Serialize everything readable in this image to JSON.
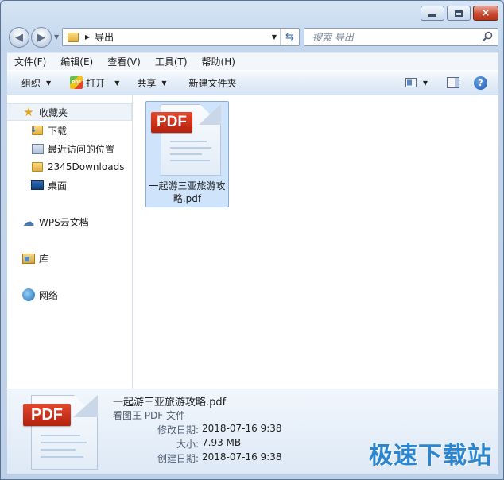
{
  "window": {
    "caption_buttons": {
      "minimize": "minimize-icon",
      "maximize": "maximize-icon",
      "close": "×"
    }
  },
  "address_bar": {
    "path": [
      "导出"
    ],
    "current": "导出",
    "search_placeholder": "搜索 导出"
  },
  "menu": [
    "文件(F)",
    "编辑(E)",
    "查看(V)",
    "工具(T)",
    "帮助(H)"
  ],
  "toolbar": {
    "organize": "组织",
    "open": "打开",
    "share": "共享",
    "new_folder": "新建文件夹",
    "help": "?"
  },
  "nav": {
    "favorites": "收藏夹",
    "downloads": "下载",
    "recent": "最近访问的位置",
    "folder_2345": "2345Downloads",
    "desktop": "桌面",
    "wps_cloud": "WPS云文档",
    "libraries": "库",
    "network": "网络"
  },
  "files": [
    {
      "name": "一起游三亚旅游攻略.pdf",
      "badge": "PDF",
      "selected": true
    }
  ],
  "details": {
    "name": "一起游三亚旅游攻略.pdf",
    "type": "看图王 PDF 文件",
    "badge": "PDF",
    "fields": [
      {
        "label": "修改日期:",
        "value": "2018-07-16 9:38"
      },
      {
        "label": "大小:",
        "value": "7.93 MB"
      },
      {
        "label": "创建日期:",
        "value": "2018-07-16 9:38"
      }
    ]
  },
  "watermark": "极速下载站",
  "colors": {
    "selection": "#cfe4fb",
    "pdf_red": "#c8321a",
    "watermark": "#2c86cf"
  }
}
